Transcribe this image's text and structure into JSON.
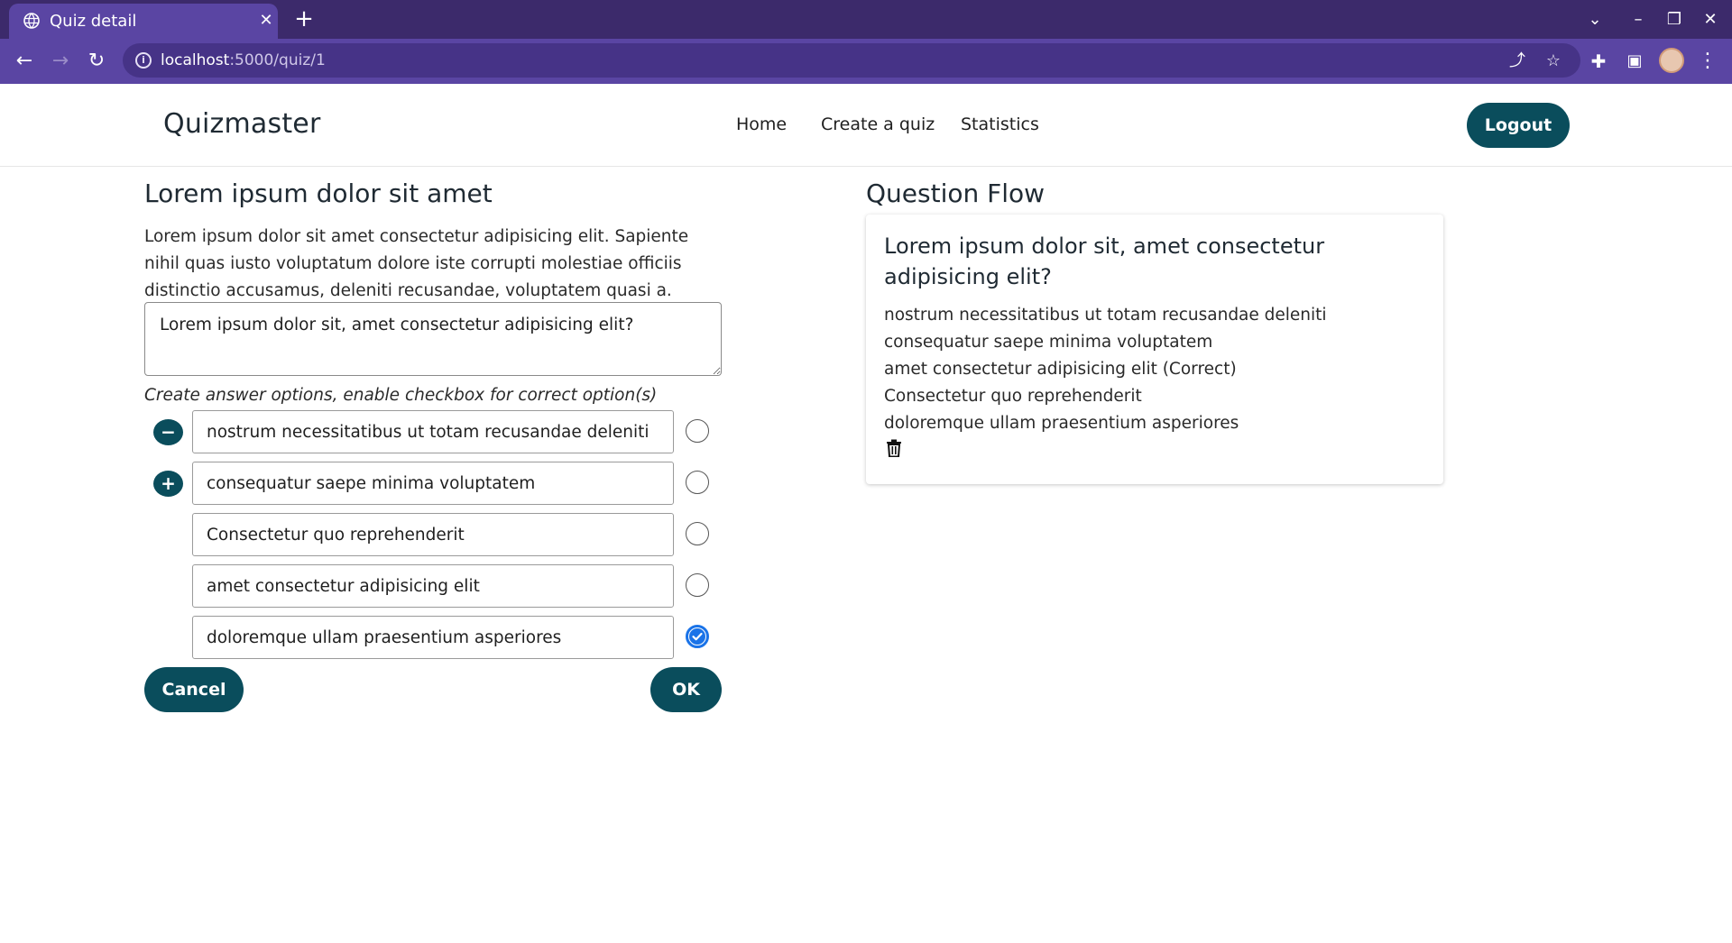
{
  "browser": {
    "tab_title": "Quiz detail",
    "url_host": "localhost",
    "url_path": ":5000/quiz/1"
  },
  "header": {
    "brand": "Quizmaster",
    "nav": [
      "Home",
      "Create a quiz",
      "Statistics"
    ],
    "logout_label": "Logout"
  },
  "editor": {
    "title": "Lorem ipsum dolor sit amet",
    "description": "Lorem ipsum dolor sit amet consectetur adipisicing elit. Sapiente nihil quas iusto voluptatum dolore iste corrupti molestiae officiis distinctio accusamus, deleniti recusandae, voluptatem quasi a.",
    "question_text": "Lorem ipsum dolor sit, amet consectetur adipisicing elit?",
    "hint": "Create answer options, enable checkbox for correct option(s)",
    "options": [
      {
        "text": "nostrum necessitatibus ut totam recusandae deleniti",
        "correct": false
      },
      {
        "text": "consequatur saepe minima voluptatem",
        "correct": false
      },
      {
        "text": "Consectetur quo reprehenderit",
        "correct": false
      },
      {
        "text": "amet consectetur adipisicing elit",
        "correct": false
      },
      {
        "text": "doloremque ullam praesentium asperiores",
        "correct": true
      }
    ],
    "remove_glyph": "−",
    "add_glyph": "+",
    "cancel_label": "Cancel",
    "ok_label": "OK"
  },
  "flow": {
    "title": "Question Flow",
    "question": "Lorem ipsum dolor sit, amet consectetur adipisicing elit?",
    "answers": [
      "nostrum necessitatibus ut totam recusandae deleniti",
      "consequatur saepe minima voluptatem",
      "amet consectetur adipisicing elit (Correct)",
      "Consectetur quo reprehenderit",
      "doloremque ullam praesentium asperiores"
    ]
  },
  "colors": {
    "primary": "#0a4d5c",
    "chrome_dark": "#3c2a6b",
    "chrome_light": "#5a45a3",
    "radio_checked": "#1a73e8"
  }
}
